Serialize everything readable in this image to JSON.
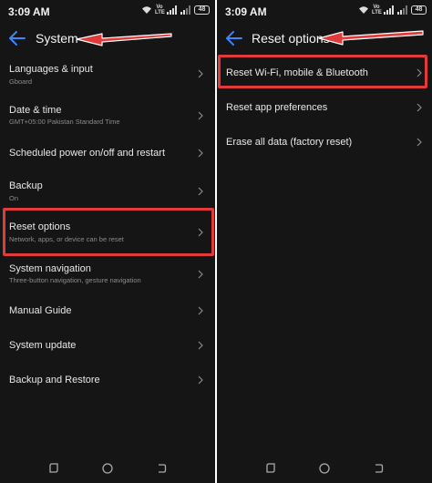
{
  "colors": {
    "background": "#151515",
    "accent": "#3a86ff",
    "highlight": "#e03a3a",
    "text": "#e8e8e8",
    "subtext": "#8b8b8b"
  },
  "left": {
    "status": {
      "time": "3:09 AM",
      "volte": "Vo LTE",
      "battery": "48"
    },
    "title": "System",
    "items": [
      {
        "title": "Languages & input",
        "subtitle": "Gboard"
      },
      {
        "title": "Date & time",
        "subtitle": "GMT+05:00 Pakistan Standard Time"
      },
      {
        "title": "Scheduled power on/off and restart"
      },
      {
        "title": "Backup",
        "subtitle": "On"
      },
      {
        "title": "Reset options",
        "subtitle": "Network, apps, or device can be reset"
      },
      {
        "title": "System navigation",
        "subtitle": "Three-button navigation, gesture navigation"
      },
      {
        "title": "Manual Guide"
      },
      {
        "title": "System update"
      },
      {
        "title": "Backup and Restore"
      }
    ]
  },
  "right": {
    "status": {
      "time": "3:09 AM",
      "volte": "Vo LTE",
      "battery": "48"
    },
    "title": "Reset options",
    "items": [
      {
        "title": "Reset Wi-Fi, mobile & Bluetooth"
      },
      {
        "title": "Reset app preferences"
      },
      {
        "title": "Erase all data (factory reset)"
      }
    ]
  },
  "icons": {
    "back": "back-arrow-icon",
    "chevron": "chevron-right-icon",
    "wifi": "wifi-icon",
    "signal": "signal-icon",
    "battery": "battery-icon",
    "annotation": "red-arrow-annotation",
    "nav_recent": "recents-icon",
    "nav_home": "home-icon",
    "nav_back": "nav-back-icon"
  }
}
